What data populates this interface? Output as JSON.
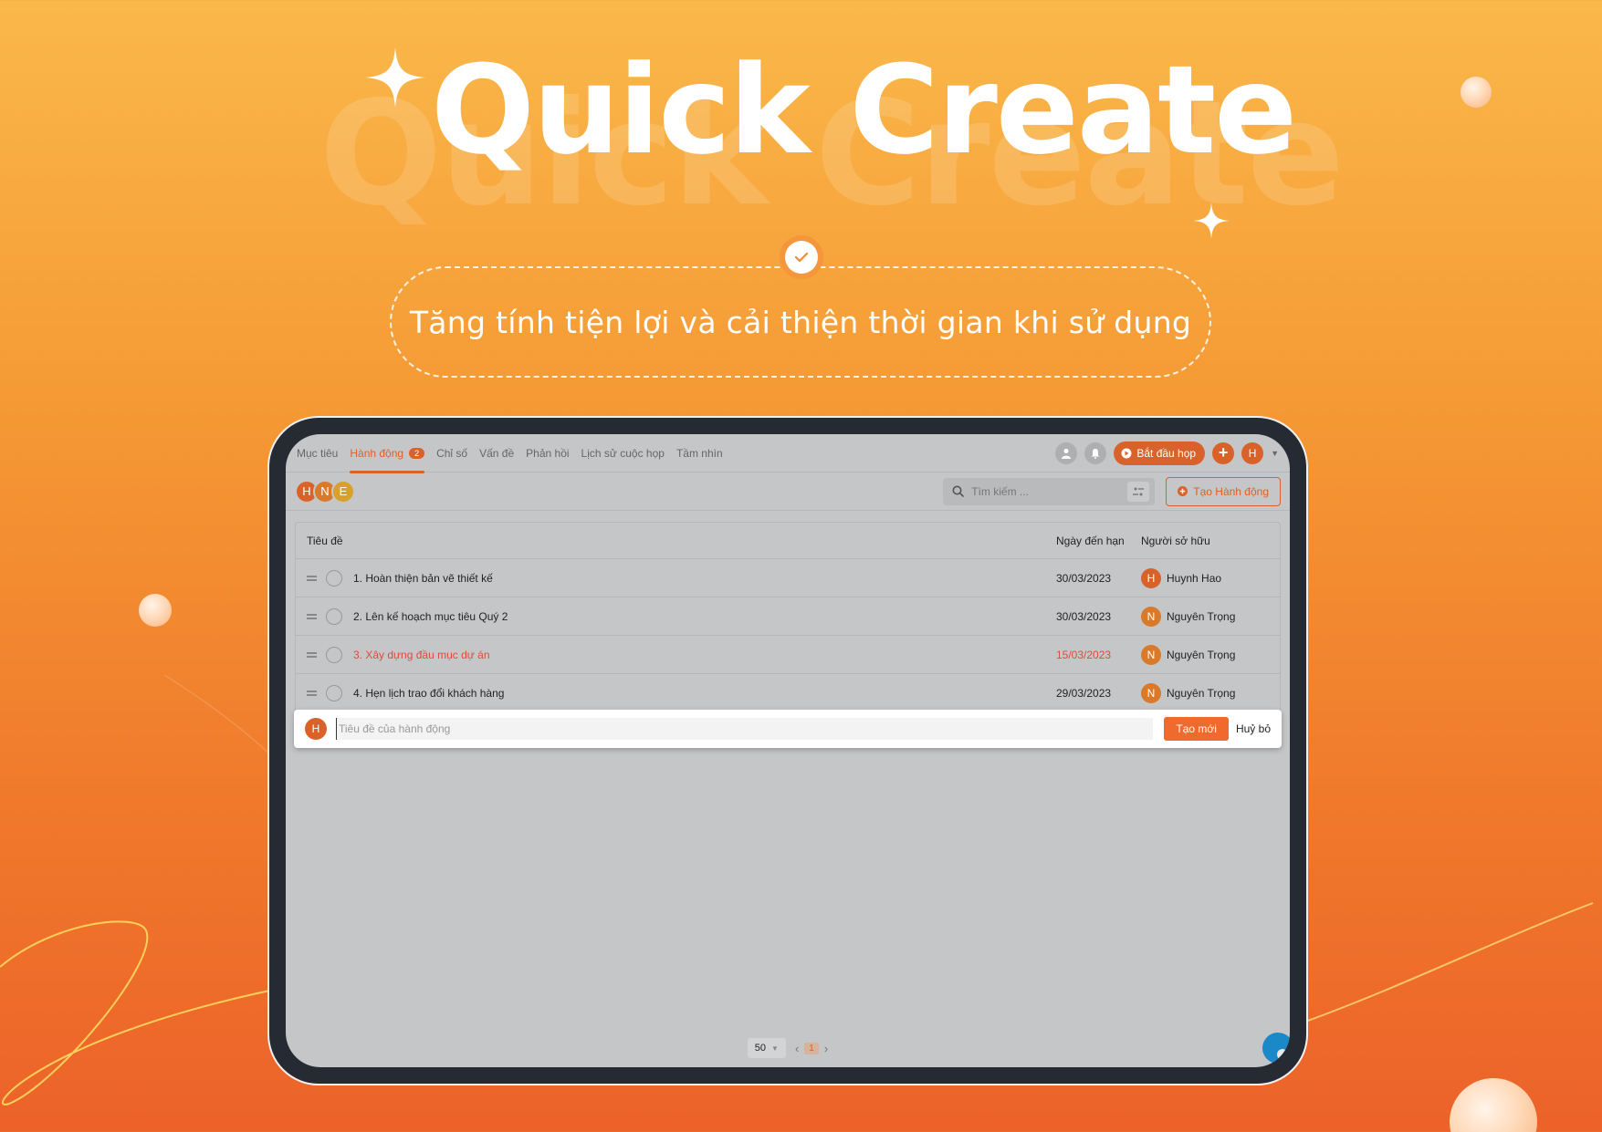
{
  "hero": {
    "title": "Quick Create",
    "watermark": "Quick Create",
    "tagline": "Tăng tính tiện lợi và cải thiện thời gian khi sử dụng"
  },
  "nav": {
    "tabs": [
      {
        "label": "Mục tiêu"
      },
      {
        "label": "Hành động",
        "badge": "2"
      },
      {
        "label": "Chỉ số"
      },
      {
        "label": "Vấn đề"
      },
      {
        "label": "Phản hồi"
      },
      {
        "label": "Lịch sử cuộc họp"
      },
      {
        "label": "Tầm nhìn"
      }
    ],
    "start_meeting": "Bắt đầu họp",
    "user_initial": "H"
  },
  "toolbar": {
    "avatars": [
      "H",
      "N",
      "E"
    ],
    "search_placeholder": "Tìm kiếm ...",
    "create_action": "Tạo Hành động"
  },
  "table": {
    "headers": {
      "title": "Tiêu đề",
      "due": "Ngày đến hạn",
      "owner": "Người sở hữu"
    },
    "rows": [
      {
        "title": "1. Hoàn thiện bản vẽ thiết kế",
        "due": "30/03/2023",
        "owner_initial": "H",
        "owner": "Huynh Hao",
        "overdue": false
      },
      {
        "title": "2. Lên kế hoạch mục tiêu Quý 2",
        "due": "30/03/2023",
        "owner_initial": "N",
        "owner": "Nguyên Trọng",
        "overdue": false
      },
      {
        "title": "3. Xây dựng đầu mục dự án",
        "due": "15/03/2023",
        "owner_initial": "N",
        "owner": "Nguyên Trọng",
        "overdue": true
      },
      {
        "title": "4. Hẹn lịch trao đổi khách hàng",
        "due": "29/03/2023",
        "owner_initial": "N",
        "owner": "Nguyên Trọng",
        "overdue": false
      }
    ]
  },
  "quick_create": {
    "avatar": "H",
    "placeholder": "Tiêu đề của hành động",
    "value": "",
    "create": "Tạo mới",
    "cancel": "Huỷ bỏ"
  },
  "pager": {
    "page_size": "50",
    "current_page": "1"
  },
  "colors": {
    "accent": "#d9622a",
    "overdue": "#e04a3c",
    "bg_top": "#fab84a",
    "bg_bottom": "#ec6229"
  }
}
